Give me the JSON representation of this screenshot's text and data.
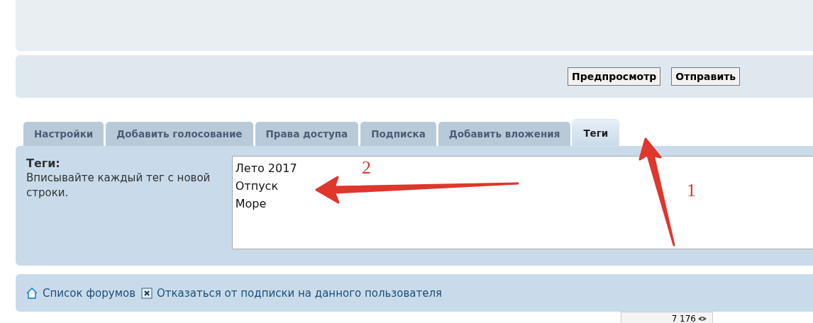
{
  "actions": {
    "buttons": [
      {
        "label": "Предпросмотр"
      },
      {
        "label": "Отправить"
      }
    ]
  },
  "tabs": [
    {
      "label": "Настройки",
      "selected": false
    },
    {
      "label": "Добавить голосование",
      "selected": false
    },
    {
      "label": "Права доступа",
      "selected": false
    },
    {
      "label": "Подписка",
      "selected": false
    },
    {
      "label": "Добавить вложения",
      "selected": false
    },
    {
      "label": "Теги",
      "selected": true
    }
  ],
  "tags": {
    "title": "Теги:",
    "hint": "Вписывайте каждый тег с новой строки.",
    "value": "Лето 2017\nОтпуск\nМоре"
  },
  "annotations": [
    {
      "label": "2",
      "kind": "left"
    },
    {
      "label": "1",
      "kind": "up"
    }
  ],
  "footer_links": [
    {
      "label": "Список форумов",
      "kind": "home"
    },
    {
      "label": "Отказаться от подписки на данного пользователя",
      "kind": "unsubscribe"
    }
  ],
  "views": {
    "count": "7 176"
  }
}
